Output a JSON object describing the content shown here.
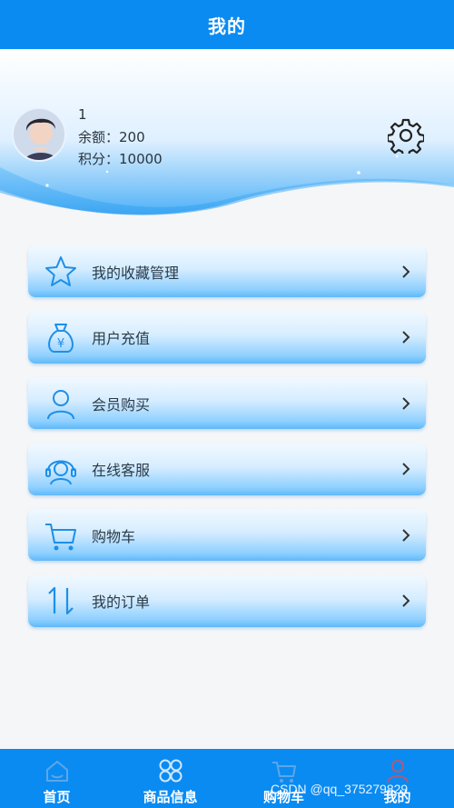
{
  "header": {
    "title": "我的"
  },
  "user": {
    "name": "1",
    "balance_text": "余额：200",
    "points_text": "积分：10000"
  },
  "menu": [
    {
      "label": "我的收藏管理",
      "icon": "star-icon"
    },
    {
      "label": "用户充值",
      "icon": "money-bag-icon"
    },
    {
      "label": "会员购买",
      "icon": "user-icon"
    },
    {
      "label": "在线客服",
      "icon": "headset-icon"
    },
    {
      "label": "购物车",
      "icon": "cart-icon"
    },
    {
      "label": "我的订单",
      "icon": "sort-arrows-icon"
    }
  ],
  "nav": [
    {
      "label": "首页",
      "icon": "home-icon"
    },
    {
      "label": "商品信息",
      "icon": "grid-icon"
    },
    {
      "label": "购物车",
      "icon": "cart-icon"
    },
    {
      "label": "我的",
      "icon": "user-icon"
    }
  ],
  "watermark": "CSDN @qq_375279829",
  "colors": {
    "primary": "#0a8bf2",
    "menu_gradient_bottom": "#5fb9f8",
    "icon_blue": "#1e8fe8"
  }
}
